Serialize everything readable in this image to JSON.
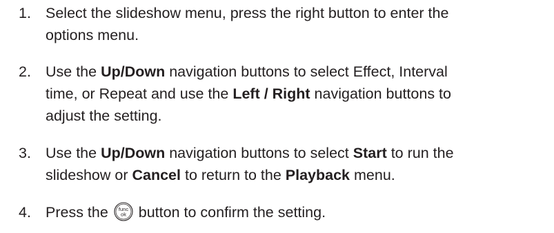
{
  "steps": [
    {
      "number": "1.",
      "lines": [
        {
          "text": "Select the slideshow menu, press the right button to enter the"
        },
        {
          "text": "options menu."
        }
      ]
    },
    {
      "number": "2.",
      "lines": [
        {
          "a": "Use the ",
          "b1": "Up/Down",
          "c": " navigation buttons to select Effect, Interval"
        },
        {
          "text": "time, or Repeat and use the ",
          "b1": "Left / Right",
          "c": " navigation buttons to"
        },
        {
          "text": "adjust the setting."
        }
      ]
    },
    {
      "number": "3.",
      "lines": [
        {
          "a": "Use the ",
          "b1": "Up/Down",
          "c": " navigation buttons to select ",
          "b2": "Start",
          "d": " to run the"
        },
        {
          "a": "slideshow or ",
          "b1": "Cancel",
          "c": " to return to the ",
          "b2": "Playback",
          "d": " menu."
        }
      ]
    },
    {
      "number": "4.",
      "lines": [
        {
          "a": "Press the ",
          "icon_top": "func",
          "icon_bottom": "ok",
          "icon_name": "func-ok-button-icon",
          "c": " button to confirm the setting."
        }
      ]
    }
  ]
}
